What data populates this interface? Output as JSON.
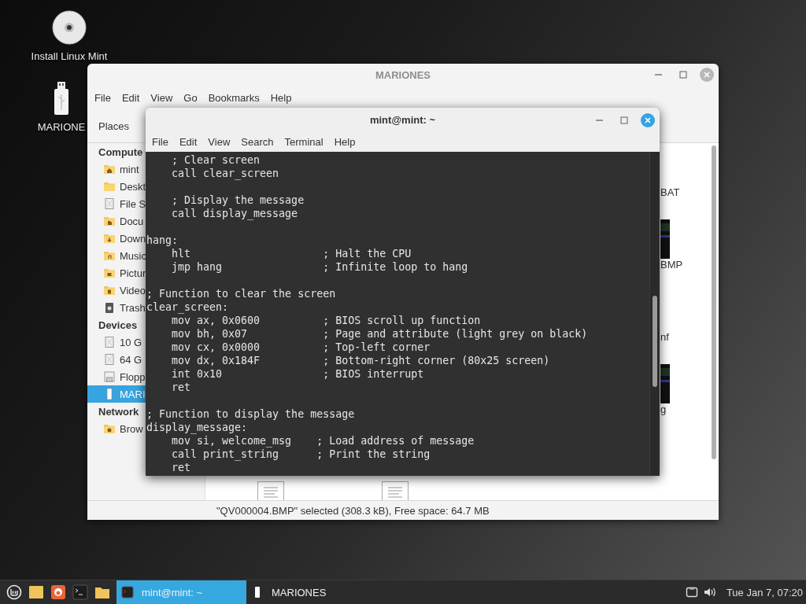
{
  "desktop_icons": [
    {
      "label": "Install Linux Mint",
      "kind": "disc"
    },
    {
      "label": "MARIONE",
      "kind": "usb"
    }
  ],
  "file_manager": {
    "title": "MARIONES",
    "active": false,
    "menu": [
      "File",
      "Edit",
      "View",
      "Go",
      "Bookmarks",
      "Help"
    ],
    "sidebar": {
      "header": "Places",
      "sections": [
        {
          "title": "Compute",
          "items": [
            {
              "label": "mint",
              "kind": "home",
              "selected": false
            },
            {
              "label": "Deskt",
              "kind": "folder",
              "selected": false
            },
            {
              "label": "File S",
              "kind": "drive",
              "selected": false
            },
            {
              "label": "Docu",
              "kind": "documents",
              "selected": false
            },
            {
              "label": "Down",
              "kind": "downloads",
              "selected": false
            },
            {
              "label": "Music",
              "kind": "music",
              "selected": false
            },
            {
              "label": "Pictur",
              "kind": "pictures",
              "selected": false
            },
            {
              "label": "Video",
              "kind": "videos",
              "selected": false
            },
            {
              "label": "Trash",
              "kind": "trash",
              "selected": false
            }
          ]
        },
        {
          "title": "Devices",
          "items": [
            {
              "label": "10 G",
              "kind": "disk",
              "selected": false
            },
            {
              "label": "64 G",
              "kind": "disk",
              "selected": false
            },
            {
              "label": "Flopp",
              "kind": "floppy",
              "selected": false
            },
            {
              "label": "MARI",
              "kind": "usb",
              "selected": true
            }
          ]
        },
        {
          "title": "Network",
          "items": [
            {
              "label": "Brow",
              "kind": "network",
              "selected": false
            }
          ]
        }
      ]
    },
    "files": [
      {
        "label": "BAT",
        "kind": "text"
      },
      {
        "label": "BMP",
        "kind": "image"
      },
      {
        "label": "nf",
        "kind": "text"
      },
      {
        "label": "g",
        "kind": "image"
      }
    ],
    "status": "\"QV000004.BMP\" selected (308.3 kB), Free space: 64.7 MB"
  },
  "terminal": {
    "title": "mint@mint: ~",
    "active": true,
    "menu": [
      "File",
      "Edit",
      "View",
      "Search",
      "Terminal",
      "Help"
    ],
    "output": "    ; Clear screen\n    call clear_screen\n\n    ; Display the message\n    call display_message\n\nhang:\n    hlt                     ; Halt the CPU\n    jmp hang                ; Infinite loop to hang\n\n; Function to clear the screen\nclear_screen:\n    mov ax, 0x0600          ; BIOS scroll up function\n    mov bh, 0x07            ; Page and attribute (light grey on black)\n    mov cx, 0x0000          ; Top-left corner\n    mov dx, 0x184F          ; Bottom-right corner (80x25 screen)\n    int 0x10                ; BIOS interrupt\n    ret\n\n; Function to display the message\ndisplay_message:\n    mov si, welcome_msg    ; Load address of message\n    call print_string      ; Print the string\n    ret"
  },
  "taskbar": {
    "windows": [
      {
        "label": "mint@mint: ~",
        "kind": "terminal",
        "selected": true
      },
      {
        "label": "MARIONES",
        "kind": "usb",
        "selected": false
      }
    ],
    "clock": "Tue Jan 7, 07:20"
  }
}
